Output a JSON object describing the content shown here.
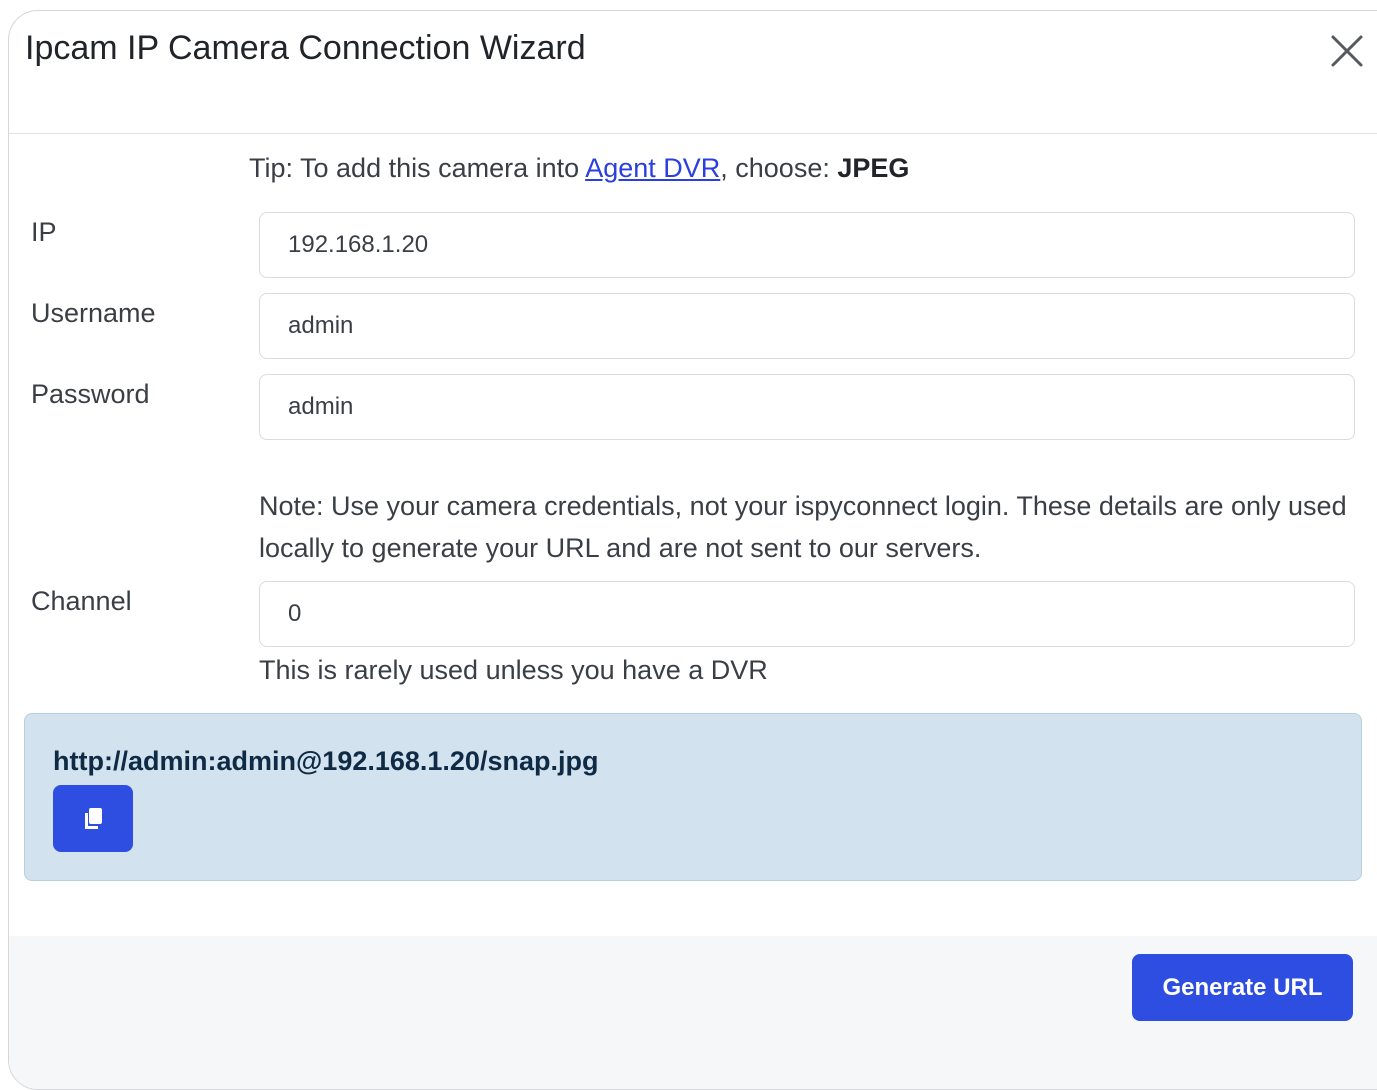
{
  "dialog": {
    "title": "Ipcam IP Camera Connection Wizard",
    "close_icon": "close-icon"
  },
  "tip": {
    "prefix": "Tip: To add this camera into ",
    "link_text": "Agent DVR",
    "middle": ", choose: ",
    "format": "JPEG"
  },
  "fields": {
    "ip": {
      "label": "IP",
      "value": "192.168.1.20"
    },
    "username": {
      "label": "Username",
      "value": "admin"
    },
    "password": {
      "label": "Password",
      "value": "admin"
    },
    "channel": {
      "label": "Channel",
      "value": "0"
    }
  },
  "note": "Note: Use your camera credentials, not your ispyconnect login. These details are only used locally to generate your URL and are not sent to our servers.",
  "channel_help": "This is rarely used unless you have a DVR",
  "result": {
    "url": "http://admin:admin@192.168.1.20/snap.jpg",
    "copy_icon": "copy-icon"
  },
  "footer": {
    "generate_label": "Generate URL"
  },
  "colors": {
    "primary": "#2d4ee0",
    "alert_bg": "#d2e2ef",
    "link": "#2b3fe0"
  }
}
